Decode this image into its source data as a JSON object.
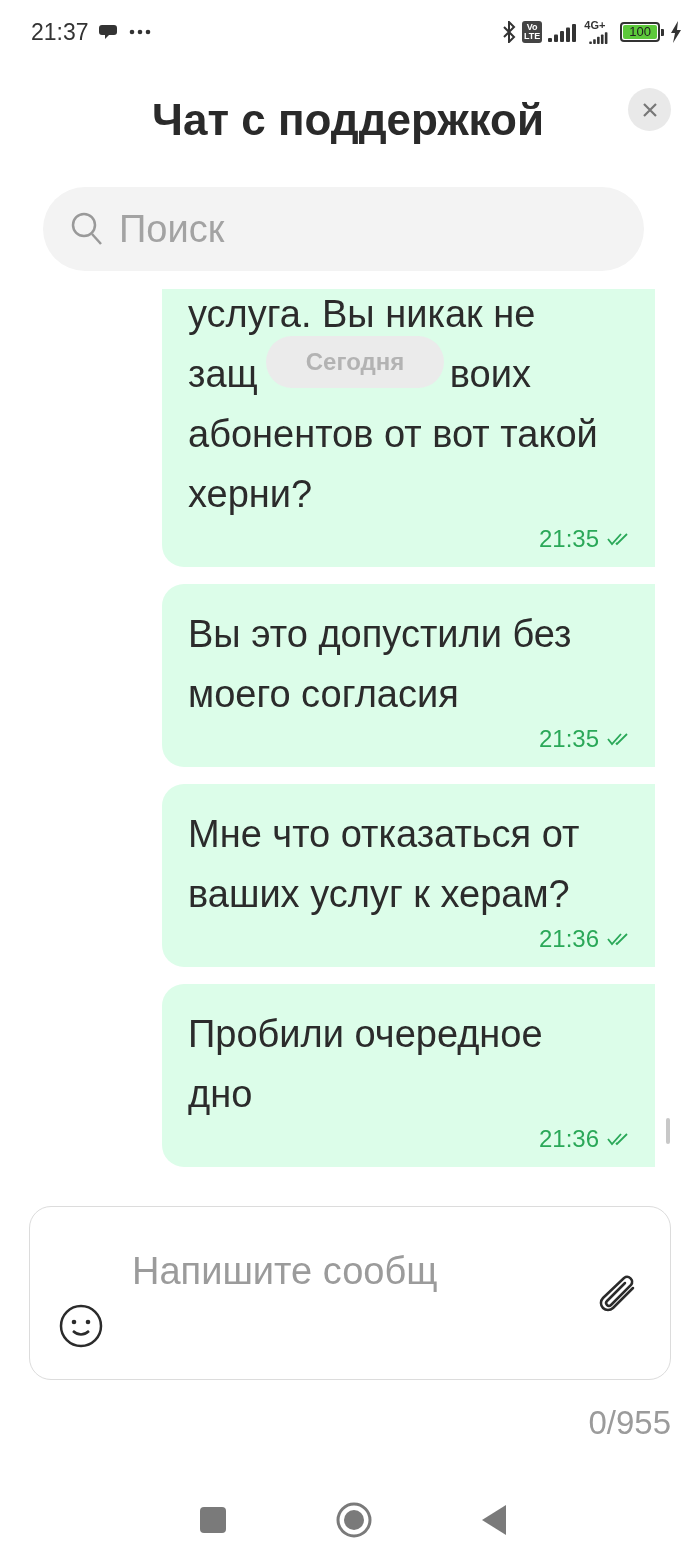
{
  "status_bar": {
    "time": "21:37",
    "volte": [
      "Vo",
      "LTE"
    ],
    "network": "4G+",
    "battery": "100"
  },
  "header": {
    "title": "Чат с поддержкой"
  },
  "search": {
    "placeholder": "Поиск"
  },
  "date_chip": "Сегодня",
  "messages": [
    {
      "lines": [
        "услуга. Вы никак не",
        {
          "start": "защ",
          "end": "воих"
        },
        "абонентов от вот такой херни?"
      ],
      "time": "21:35",
      "read": true
    },
    {
      "lines": [
        "Вы это допустили без моего согласия"
      ],
      "time": "21:35",
      "read": true
    },
    {
      "lines": [
        "Мне что отказаться от ваших услуг к херам?"
      ],
      "time": "21:36",
      "read": true
    },
    {
      "lines": [
        "Пробили очередное дно"
      ],
      "time": "21:36",
      "read": true
    }
  ],
  "composer": {
    "placeholder": "Напишите сообщ",
    "counter": "0/955"
  }
}
